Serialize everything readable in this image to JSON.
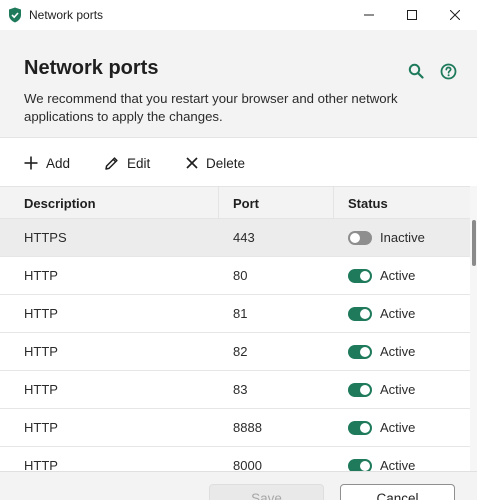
{
  "window": {
    "title": "Network ports",
    "icons": {
      "app": "shield-icon",
      "minimize": "minimize-icon",
      "maximize": "maximize-icon",
      "close": "close-icon"
    }
  },
  "header": {
    "title": "Network ports",
    "hint": "We recommend that you restart your browser and other network applications to apply the changes.",
    "icons": {
      "search": "search-icon",
      "help": "help-icon"
    }
  },
  "toolbar": {
    "add_label": "Add",
    "edit_label": "Edit",
    "delete_label": "Delete"
  },
  "table": {
    "columns": {
      "description": "Description",
      "port": "Port",
      "status": "Status"
    },
    "rows": [
      {
        "description": "HTTPS",
        "port": "443",
        "status": "Inactive",
        "enabled": false
      },
      {
        "description": "HTTP",
        "port": "80",
        "status": "Active",
        "enabled": true
      },
      {
        "description": "HTTP",
        "port": "81",
        "status": "Active",
        "enabled": true
      },
      {
        "description": "HTTP",
        "port": "82",
        "status": "Active",
        "enabled": true
      },
      {
        "description": "HTTP",
        "port": "83",
        "status": "Active",
        "enabled": true
      },
      {
        "description": "HTTP",
        "port": "8888",
        "status": "Active",
        "enabled": true
      },
      {
        "description": "HTTP",
        "port": "8000",
        "status": "Active",
        "enabled": true
      }
    ]
  },
  "footer": {
    "save_label": "Save",
    "cancel_label": "Cancel"
  },
  "colors": {
    "accent": "#1f7a5c",
    "toggle_off": "#8e8e8e",
    "header_bg": "#f3f3f3",
    "selected_row": "#ececec"
  }
}
